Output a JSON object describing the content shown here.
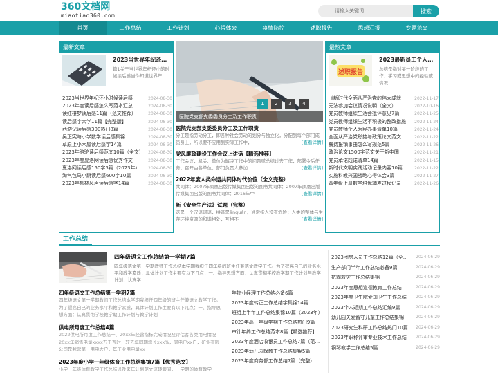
{
  "logo": {
    "name": "360文档网",
    "domain": "miaotiao360.com"
  },
  "search": {
    "placeholder": "请输入关键词",
    "button": "搜索"
  },
  "nav": [
    "首页",
    "工作总结",
    "工作计划",
    "心得体会",
    "疫情防控",
    "述职报告",
    "思想汇报",
    "专题范文"
  ],
  "latest": {
    "title": "最新文章",
    "featured": {
      "title": "2023当世界年纪还小时候",
      "desc": "篇1关于当世界年纪还小的时候读后感当你知道世界年"
    },
    "items": [
      {
        "t": "2023当世界年纪还小时候读后感",
        "d": "2024-08-30"
      },
      {
        "t": "2023年度读后感怎么写范本汇总",
        "d": "2024-08-30"
      },
      {
        "t": "读红楼梦读后感11篇（范文推荐）",
        "d": "2024-08-30"
      },
      {
        "t": "读后感字大学11篇【完整版】",
        "d": "2024-08-30"
      },
      {
        "t": "西游记读后感300热门8篇",
        "d": "2024-08-30"
      },
      {
        "t": "吴正宪与小学数学读后感集锦",
        "d": "2024-08-30"
      },
      {
        "t": "草原上小木屋读后感字14篇",
        "d": "2024-08-30"
      },
      {
        "t": "2023年骆驼读后感范文10篇（全文）",
        "d": "2024-08-30"
      },
      {
        "t": "2023年度夏洛网读后感优秀作文",
        "d": "2024-08-30"
      },
      {
        "t": "夏洛网读后感150字3篇（2023年）",
        "d": "2024-08-30"
      },
      {
        "t": "淘气包马小跳读后感600字10篇",
        "d": "2024-08-30"
      },
      {
        "t": "2023年柳林风声读后感字14篇",
        "d": "2024-08-30"
      }
    ]
  },
  "slider": {
    "caption": "医院党支部支委委员分工及工作职责",
    "pages": [
      "1",
      "2",
      "3",
      "4"
    ]
  },
  "news": [
    {
      "h": "医院党支部支委委员分工及工作职责",
      "b": "分工是指劳动分工，即各种社会劳动的划分与独立化，分配到每个部门成员身上，所以要不应用到实际工作中，"
    },
    {
      "h": "党风廉政建设工作会议上讲话【精选推荐】",
      "b": "工作会议，机关、单位为解决工作中的问题或总结过去工作，部署今后任务，召开由各单位、部门负责人参加"
    },
    {
      "h": "2022年度人类命运共同体时代价值（全文完整）",
      "b": "共同体：2007年凤凰出版传媒集团出版的图书共同体：2007年凤凰出版传媒集团出版的图书共同体：2016年中"
    },
    {
      "h": "新《安全生产法》试题（完整）",
      "b": "这是一个汉语词语，拼音是ānquán，通常指人没有危险；人类的整体与生存环境资源的和谐相处，互相不"
    }
  ],
  "more_label": "[查看详情]",
  "hot": {
    "title": "最热文章",
    "featured": {
      "title": "2023最新员工个人年度述",
      "desc": "总结是指对某一阶段的工作、学习或思想中的经验或情况"
    },
    "items": [
      {
        "t": "《新时代全面从严治党的伟大成就",
        "d": "2022-11-17"
      },
      {
        "t": "无法参加会议情况说明（全文）",
        "d": "2022-10-16"
      },
      {
        "t": "党员教师组织生活会批评意见7篇",
        "d": "2022-11-25"
      },
      {
        "t": "党员教师组织生活不积极的整改措施",
        "d": "2022-11-24"
      },
      {
        "t": "党员教师个人为民办事清单10篇",
        "d": "2022-11-24"
      },
      {
        "t": "全面从严治党形势与政策论文范文",
        "d": "2022-11-22"
      },
      {
        "t": "餐费报销事由怎么写规范5篇",
        "d": "2022-11-26"
      },
      {
        "t": "政治论文1500字范文关于新中国",
        "d": "2022-11-21"
      },
      {
        "t": "党员承诺践诺清单14篇",
        "d": "2022-11-15"
      },
      {
        "t": "新时代文明实践活动记录内容10篇",
        "d": "2022-11-22"
      },
      {
        "t": "实施科教兴国战略心得体会3篇",
        "d": "2022-11-27"
      },
      {
        "t": "四年级上册数学培优辅差过程记录",
        "d": "2022-11-26"
      }
    ]
  },
  "work": {
    "title": "工作总结",
    "featured": {
      "title": "四年级语文工作总结第一学期7篇",
      "desc": "四年级语文第一学期教师工作总结本学期我担任四年级的班主任兼语文教学工作。为了提高自己的业务水平和教学素质，具体计划工作主要有以下几点：一、指导思想方面：认真贯彻学校教学期工作计划与教学计划，认真学"
    },
    "articles": [
      {
        "h": "四年级语文工作总结第一学期7篇",
        "b": "四年级语文第一学期教师工作总结本学期我担任四年级的班主任兼语文教学工作。为了提高自己的业务水平和教学素质，具体计划工作主要有以下几点：一、指导思想方面：认真贯彻学校教学期工作计划与教学计划"
      },
      {
        "h": "供电所月度工作总结4篇",
        "b": "2022供电所月度工作总结一、20xx年经营指标完成情况及评估客各类用电情况20xx年销售电量xxxx万千瓦时，较去年同期增长xxx%，同电户xx户，矿业有限公司是我营第一用电大户，其工业用电量xx"
      },
      {
        "h": "2023年度小学一年级体育工作总结集锦7篇【优秀范文】",
        "b": "小学一年级体育教学工作总结以及来年计划范文这转眼间，一学期的体育教学"
      }
    ],
    "mid": [
      "年物业经理工作总结必备6篇",
      "2023年度转正工作总结字集锦14篇",
      "班组上半年工作总结集锦10篇（2023年）",
      "2023年高一年级学期工作总结热门9篇",
      "审计年终工作总结范本8篇【精选推荐】",
      "2023年度酒店收银员工作总结7篇（范文推荐）",
      "2023年幼儿园保教工作总结集锦5篇",
      "2023年度商务部工作总结7篇（完整）"
    ],
    "right": [
      {
        "t": "2023团房人员工作总结12篇（全文）",
        "d": "2024-06-29"
      },
      {
        "t": "生产部门半年工作总结必备9篇",
        "d": "2024-06-29"
      },
      {
        "t": "抗霸救灾工作总结集锦",
        "d": "2024-06-29"
      },
      {
        "t": "2023年度思想道德教育工作总结",
        "d": "2024-06-29"
      },
      {
        "t": "2023年度卫生院爱国卫生工作总结",
        "d": "2024-06-29"
      },
      {
        "t": "2023个人近期工作总结汇编9篇",
        "d": "2024-06-29"
      },
      {
        "t": "幼儿园关爱留守儿童工作总结集锦",
        "d": "2024-06-29"
      },
      {
        "t": "2023研究生科研工作总结热门10篇",
        "d": "2024-06-29"
      },
      {
        "t": "2023年职称评审专业技术工作总结",
        "d": "2024-06-29"
      },
      {
        "t": "钢琴教学工作总结5篇",
        "d": "2024-06-29"
      }
    ]
  }
}
